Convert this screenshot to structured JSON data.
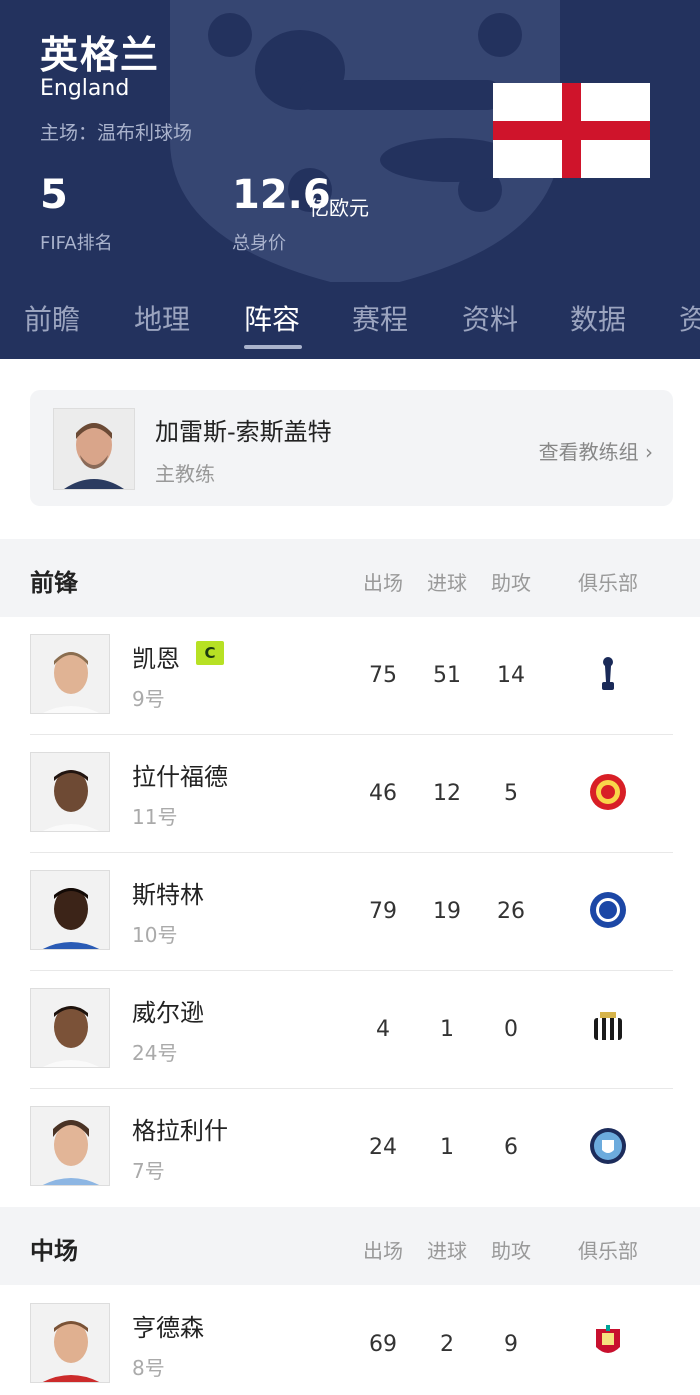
{
  "team": {
    "name_cn": "英格兰",
    "name_en": "England",
    "home": "主场：温布利球场",
    "rank_value": "5",
    "rank_label": "FIFA排名",
    "worth_value": "12.6",
    "worth_unit": "亿欧元",
    "worth_label": "总身价"
  },
  "colors": {
    "header_bg": "#23325e",
    "flag_red": "#cf142b",
    "captain_badge": "#b7e124"
  },
  "tabs": [
    {
      "label": "前瞻",
      "active": false
    },
    {
      "label": "地理",
      "active": false
    },
    {
      "label": "阵容",
      "active": true
    },
    {
      "label": "赛程",
      "active": false
    },
    {
      "label": "资料",
      "active": false
    },
    {
      "label": "数据",
      "active": false
    },
    {
      "label": "资",
      "active": false
    }
  ],
  "coach": {
    "name": "加雷斯-索斯盖特",
    "role": "主教练",
    "link": "查看教练组 ›"
  },
  "columns": [
    "出场",
    "进球",
    "助攻",
    "俱乐部"
  ],
  "sections": [
    {
      "title": "前锋",
      "players": [
        {
          "name": "凯恩",
          "number": "9号",
          "captain": "C",
          "apps": "75",
          "goals": "51",
          "assists": "14",
          "club_icon": "tottenham-crest-icon"
        },
        {
          "name": "拉什福德",
          "number": "11号",
          "apps": "46",
          "goals": "12",
          "assists": "5",
          "club_icon": "man-united-crest-icon"
        },
        {
          "name": "斯特林",
          "number": "10号",
          "apps": "79",
          "goals": "19",
          "assists": "26",
          "club_icon": "chelsea-crest-icon"
        },
        {
          "name": "威尔逊",
          "number": "24号",
          "apps": "4",
          "goals": "1",
          "assists": "0",
          "club_icon": "newcastle-crest-icon"
        },
        {
          "name": "格拉利什",
          "number": "7号",
          "apps": "24",
          "goals": "1",
          "assists": "6",
          "club_icon": "man-city-crest-icon"
        }
      ]
    },
    {
      "title": "中场",
      "players": [
        {
          "name": "亨德森",
          "number": "8号",
          "apps": "69",
          "goals": "2",
          "assists": "9",
          "club_icon": "liverpool-crest-icon"
        }
      ]
    }
  ]
}
